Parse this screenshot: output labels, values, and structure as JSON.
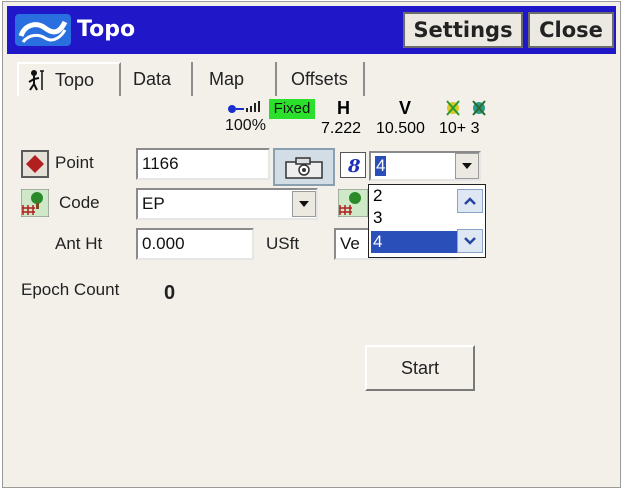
{
  "titlebar": {
    "title": "Topo",
    "settings_label": "Settings",
    "close_label": "Close"
  },
  "tabs": [
    {
      "label": "Topo",
      "active": true
    },
    {
      "label": "Data"
    },
    {
      "label": "Map"
    },
    {
      "label": "Offsets"
    }
  ],
  "status": {
    "signal_percent": "100%",
    "fix_status": "Fixed",
    "h_label": "H",
    "h_value": "7.222",
    "v_label": "V",
    "v_value": "10.500",
    "satellites": "10+ 3",
    "fix_color": "#2be02b"
  },
  "form": {
    "point_label": "Point",
    "point_value": "1166",
    "code_label": "Code",
    "code_value": "EP",
    "ant_label": "Ant Ht",
    "ant_value": "0.000",
    "ant_unit": "USft",
    "measure_prefix": "Ve",
    "increment_value": "4",
    "increment_options": [
      "2",
      "3",
      "4"
    ]
  },
  "epoch": {
    "label": "Epoch Count",
    "value": "0"
  },
  "start_label": "Start",
  "colors": {
    "titlebar": "#1f17c8",
    "selection": "#2a4fb8",
    "point_icon": "#b21f1f"
  }
}
